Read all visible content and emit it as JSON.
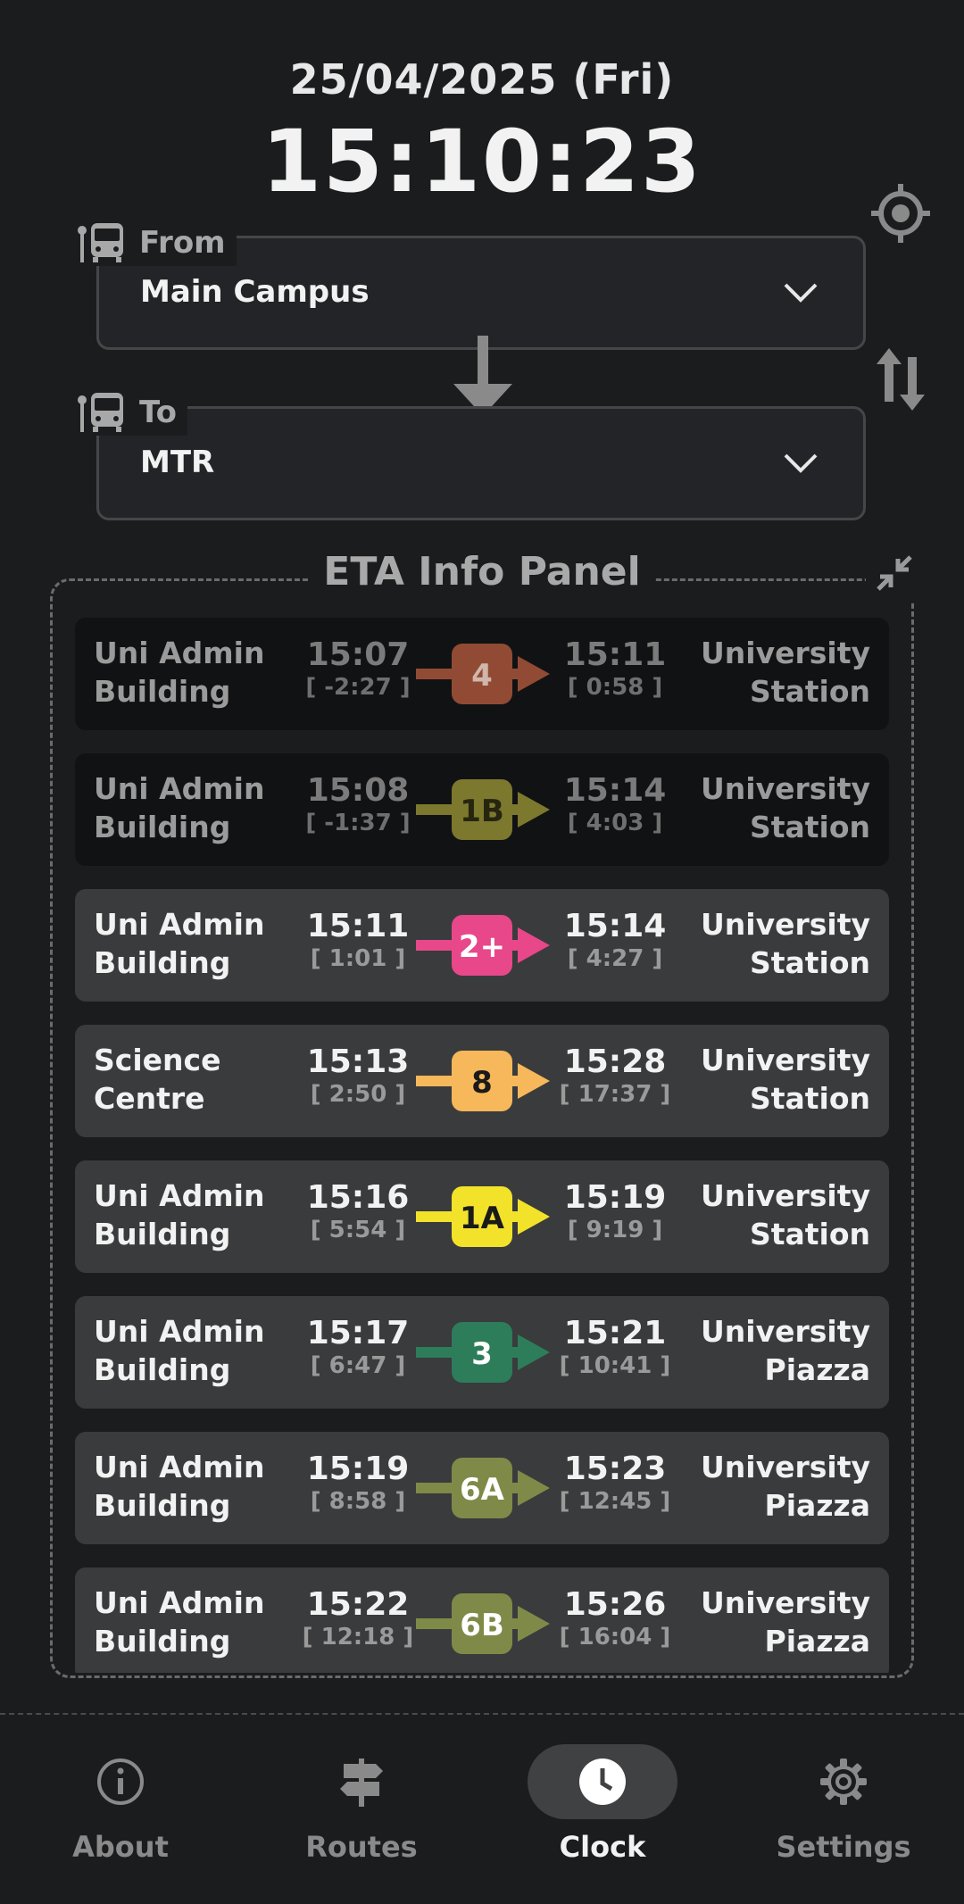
{
  "header": {
    "date": "25/04/2025 (Fri)",
    "time": "15:10:23"
  },
  "from": {
    "label": "From",
    "value": "Main Campus"
  },
  "to": {
    "label": "To",
    "value": "MTR"
  },
  "panel": {
    "title": "ETA Info Panel"
  },
  "eta_rows": [
    {
      "origin_1": "Uni Admin",
      "origin_2": "Building",
      "dep_time": "15:07",
      "dep_delta": "[ -2:27 ]",
      "route": "4",
      "route_color": "#a8553a",
      "route_text_color": "#f2d3c6",
      "arr_time": "15:11",
      "arr_delta": "[ 0:58 ]",
      "dest_1": "University",
      "dest_2": "Station",
      "state": "past"
    },
    {
      "origin_1": "Uni Admin",
      "origin_2": "Building",
      "dep_time": "15:08",
      "dep_delta": "[ -1:37 ]",
      "route": "1B",
      "route_color": "#8f8a32",
      "route_text_color": "#2a2910",
      "arr_time": "15:14",
      "arr_delta": "[ 4:03 ]",
      "dest_1": "University",
      "dest_2": "Station",
      "state": "past"
    },
    {
      "origin_1": "Uni Admin",
      "origin_2": "Building",
      "dep_time": "15:11",
      "dep_delta": "[ 1:01 ]",
      "route": "2+",
      "route_color": "#e8478a",
      "route_text_color": "#ffffff",
      "arr_time": "15:14",
      "arr_delta": "[ 4:27 ]",
      "dest_1": "University",
      "dest_2": "Station",
      "state": "active"
    },
    {
      "origin_1": "Science",
      "origin_2": "Centre",
      "dep_time": "15:13",
      "dep_delta": "[ 2:50 ]",
      "route": "8",
      "route_color": "#f6b85a",
      "route_text_color": "#1a1a1a",
      "arr_time": "15:28",
      "arr_delta": "[ 17:37 ]",
      "dest_1": "University",
      "dest_2": "Station",
      "state": "active"
    },
    {
      "origin_1": "Uni Admin",
      "origin_2": "Building",
      "dep_time": "15:16",
      "dep_delta": "[ 5:54 ]",
      "route": "1A",
      "route_color": "#f2e22a",
      "route_text_color": "#1a1a1a",
      "arr_time": "15:19",
      "arr_delta": "[ 9:19 ]",
      "dest_1": "University",
      "dest_2": "Station",
      "state": "active"
    },
    {
      "origin_1": "Uni Admin",
      "origin_2": "Building",
      "dep_time": "15:17",
      "dep_delta": "[ 6:47 ]",
      "route": "3",
      "route_color": "#2d7d5a",
      "route_text_color": "#ffffff",
      "arr_time": "15:21",
      "arr_delta": "[ 10:41 ]",
      "dest_1": "University",
      "dest_2": "Piazza",
      "state": "active"
    },
    {
      "origin_1": "Uni Admin",
      "origin_2": "Building",
      "dep_time": "15:19",
      "dep_delta": "[ 8:58 ]",
      "route": "6A",
      "route_color": "#7f8a48",
      "route_text_color": "#ffffff",
      "arr_time": "15:23",
      "arr_delta": "[ 12:45 ]",
      "dest_1": "University",
      "dest_2": "Piazza",
      "state": "active"
    },
    {
      "origin_1": "Uni Admin",
      "origin_2": "Building",
      "dep_time": "15:22",
      "dep_delta": "[ 12:18 ]",
      "route": "6B",
      "route_color": "#7f8a48",
      "route_text_color": "#ffffff",
      "arr_time": "15:26",
      "arr_delta": "[ 16:04 ]",
      "dest_1": "University",
      "dest_2": "Piazza",
      "state": "active"
    }
  ],
  "nav": {
    "items": [
      {
        "label": "About",
        "icon": "info-icon",
        "selected": false
      },
      {
        "label": "Routes",
        "icon": "signpost-icon",
        "selected": false
      },
      {
        "label": "Clock",
        "icon": "clock-icon",
        "selected": true
      },
      {
        "label": "Settings",
        "icon": "gear-icon",
        "selected": false
      }
    ]
  }
}
